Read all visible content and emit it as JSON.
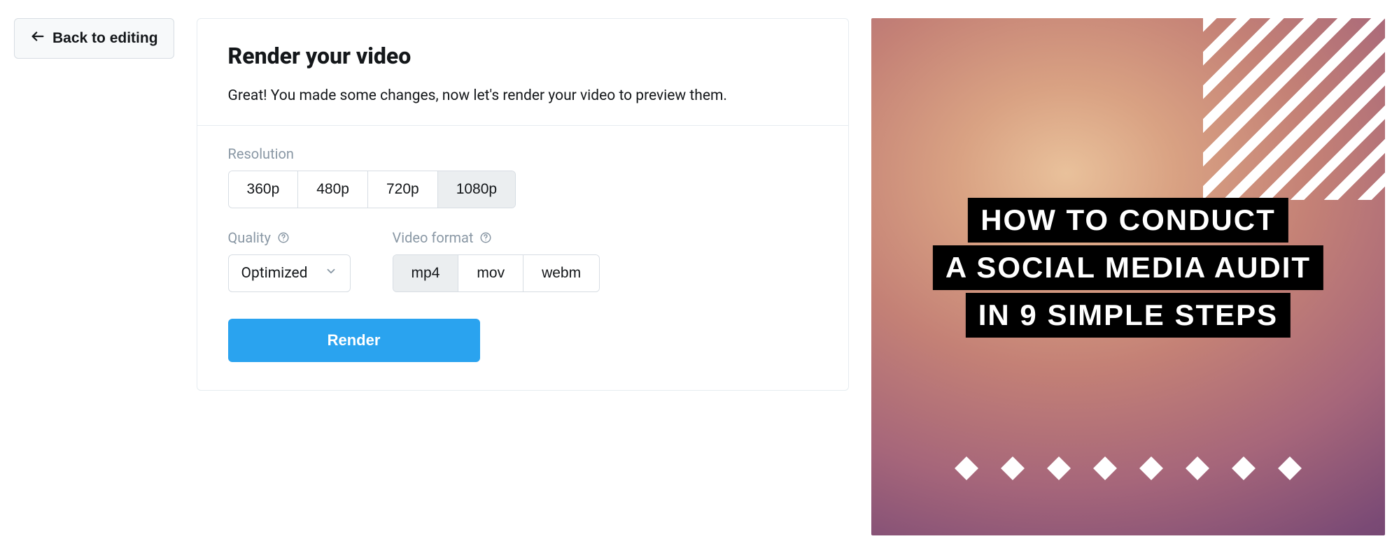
{
  "back_button": {
    "label": "Back to editing"
  },
  "card": {
    "title": "Render your video",
    "subtitle": "Great! You made some changes, now let's render your video to preview them."
  },
  "resolution": {
    "label": "Resolution",
    "options": [
      "360p",
      "480p",
      "720p",
      "1080p"
    ],
    "selected": "1080p"
  },
  "quality": {
    "label": "Quality",
    "selected": "Optimized"
  },
  "format": {
    "label": "Video format",
    "options": [
      "mp4",
      "mov",
      "webm"
    ],
    "selected": "mp4"
  },
  "render_button": {
    "label": "Render"
  },
  "preview": {
    "title_lines": [
      "HOW TO CONDUCT",
      "A SOCIAL MEDIA AUDIT",
      "IN 9 SIMPLE STEPS"
    ],
    "diamond_count": 8
  }
}
